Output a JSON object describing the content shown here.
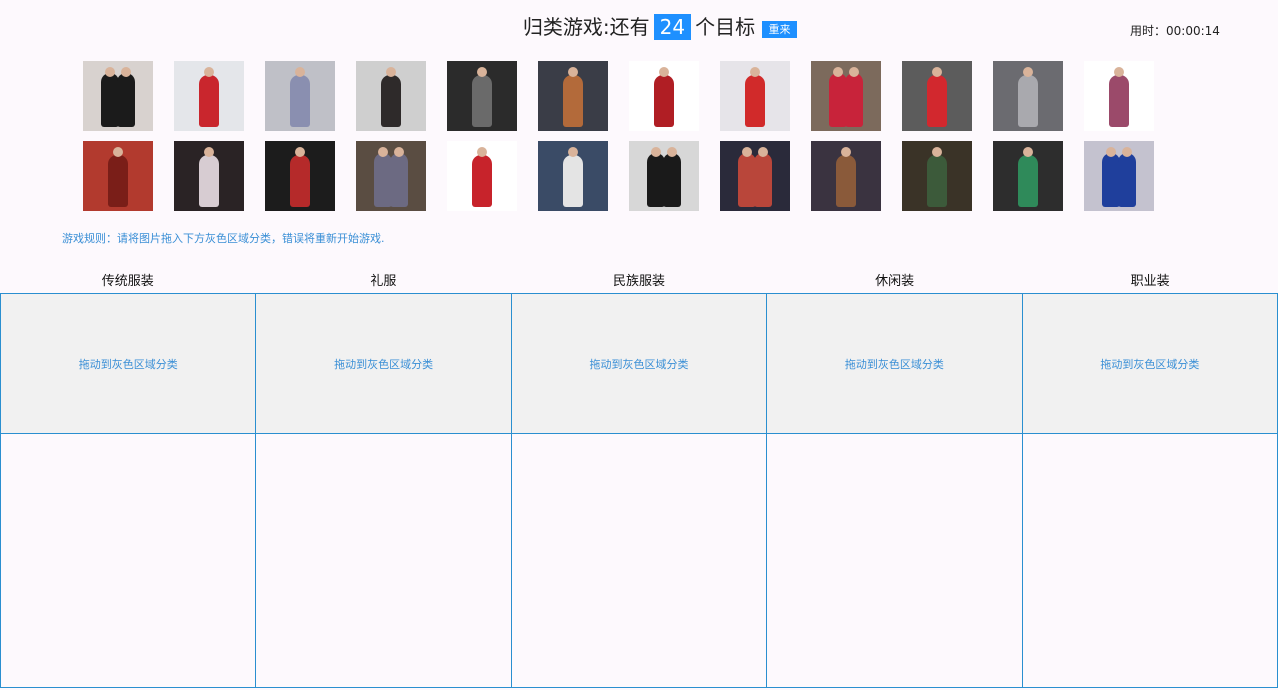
{
  "header": {
    "title_prefix": "归类游戏:还有",
    "remaining": "24",
    "title_suffix": "个目标",
    "restart_label": "重来",
    "timer_label": "用时：",
    "timer_value": "00:00:14"
  },
  "rule_text": "游戏规则：请将图片拖入下方灰色区域分类，错误将重新开始游戏.",
  "categories": [
    {
      "label": "传统服装",
      "drop_hint": "拖动到灰色区域分类"
    },
    {
      "label": "礼服",
      "drop_hint": "拖动到灰色区域分类"
    },
    {
      "label": "民族服装",
      "drop_hint": "拖动到灰色区域分类"
    },
    {
      "label": "休闲装",
      "drop_hint": "拖动到灰色区域分类"
    },
    {
      "label": "职业装",
      "drop_hint": "拖动到灰色区域分类"
    }
  ],
  "thumbnails": [
    {
      "name": "two-people-black-outfits-photo",
      "bg": "#d8d2cf",
      "fig": "#1b1b1b",
      "two": true
    },
    {
      "name": "red-uniform-woman-photo",
      "bg": "#e4e6ea",
      "fig": "#c9262d"
    },
    {
      "name": "runway-pattern-dress-photo",
      "bg": "#bfc0c7",
      "fig": "#8a8fb0"
    },
    {
      "name": "striped-coat-man-photo",
      "bg": "#cfcfcf",
      "fig": "#2e2a2a"
    },
    {
      "name": "dark-runway-man-photo",
      "bg": "#2b2b2b",
      "fig": "#6a6a6a"
    },
    {
      "name": "embroidered-jacket-man-photo",
      "bg": "#3a3d47",
      "fig": "#b36a3a"
    },
    {
      "name": "ethnic-dancer-skirt-photo",
      "bg": "#ffffff",
      "fig": "#b01e24"
    },
    {
      "name": "red-ethnic-girl-photo",
      "bg": "#e6e4e9",
      "fig": "#d12a2a"
    },
    {
      "name": "group-ethnic-costumes-photo",
      "bg": "#7c6a5c",
      "fig": "#c8233a",
      "two": true
    },
    {
      "name": "red-ethnic-dress-woman-photo",
      "bg": "#5c5c5c",
      "fig": "#d2282e"
    },
    {
      "name": "silver-gown-runway-photo",
      "bg": "#6b6b70",
      "fig": "#a9a9ae"
    },
    {
      "name": "patterned-robe-photo",
      "bg": "#ffffff",
      "fig": "#9b4a6a"
    },
    {
      "name": "red-traditional-hanfu-photo",
      "bg": "#b23a2e",
      "fig": "#7a1e18"
    },
    {
      "name": "white-gown-stage-photo",
      "bg": "#2a2325",
      "fig": "#d7ccd2"
    },
    {
      "name": "red-print-gown-runway-photo",
      "bg": "#1c1c1c",
      "fig": "#b52a2a"
    },
    {
      "name": "ethnic-group-street-photo",
      "bg": "#5a4d42",
      "fig": "#6c6a82",
      "two": true
    },
    {
      "name": "miao-costume-dancer-photo",
      "bg": "#ffffff",
      "fig": "#c7232b"
    },
    {
      "name": "white-outfit-runway-photo",
      "bg": "#3a4b66",
      "fig": "#e4e4e4"
    },
    {
      "name": "models-lineup-photo",
      "bg": "#d7d7d7",
      "fig": "#1a1a1a",
      "two": true
    },
    {
      "name": "colorful-print-models-photo",
      "bg": "#2a2a3a",
      "fig": "#b9463a",
      "two": true
    },
    {
      "name": "printed-suit-runway-photo",
      "bg": "#3a3340",
      "fig": "#8a5a3a"
    },
    {
      "name": "green-patterned-gown-photo",
      "bg": "#3a3327",
      "fig": "#3c5a3a"
    },
    {
      "name": "green-print-dress-photo",
      "bg": "#2d2d2d",
      "fig": "#2f8a5a"
    },
    {
      "name": "two-women-blue-black-photo",
      "bg": "#c4c2cf",
      "fig": "#1f3f9c",
      "two": true
    }
  ]
}
